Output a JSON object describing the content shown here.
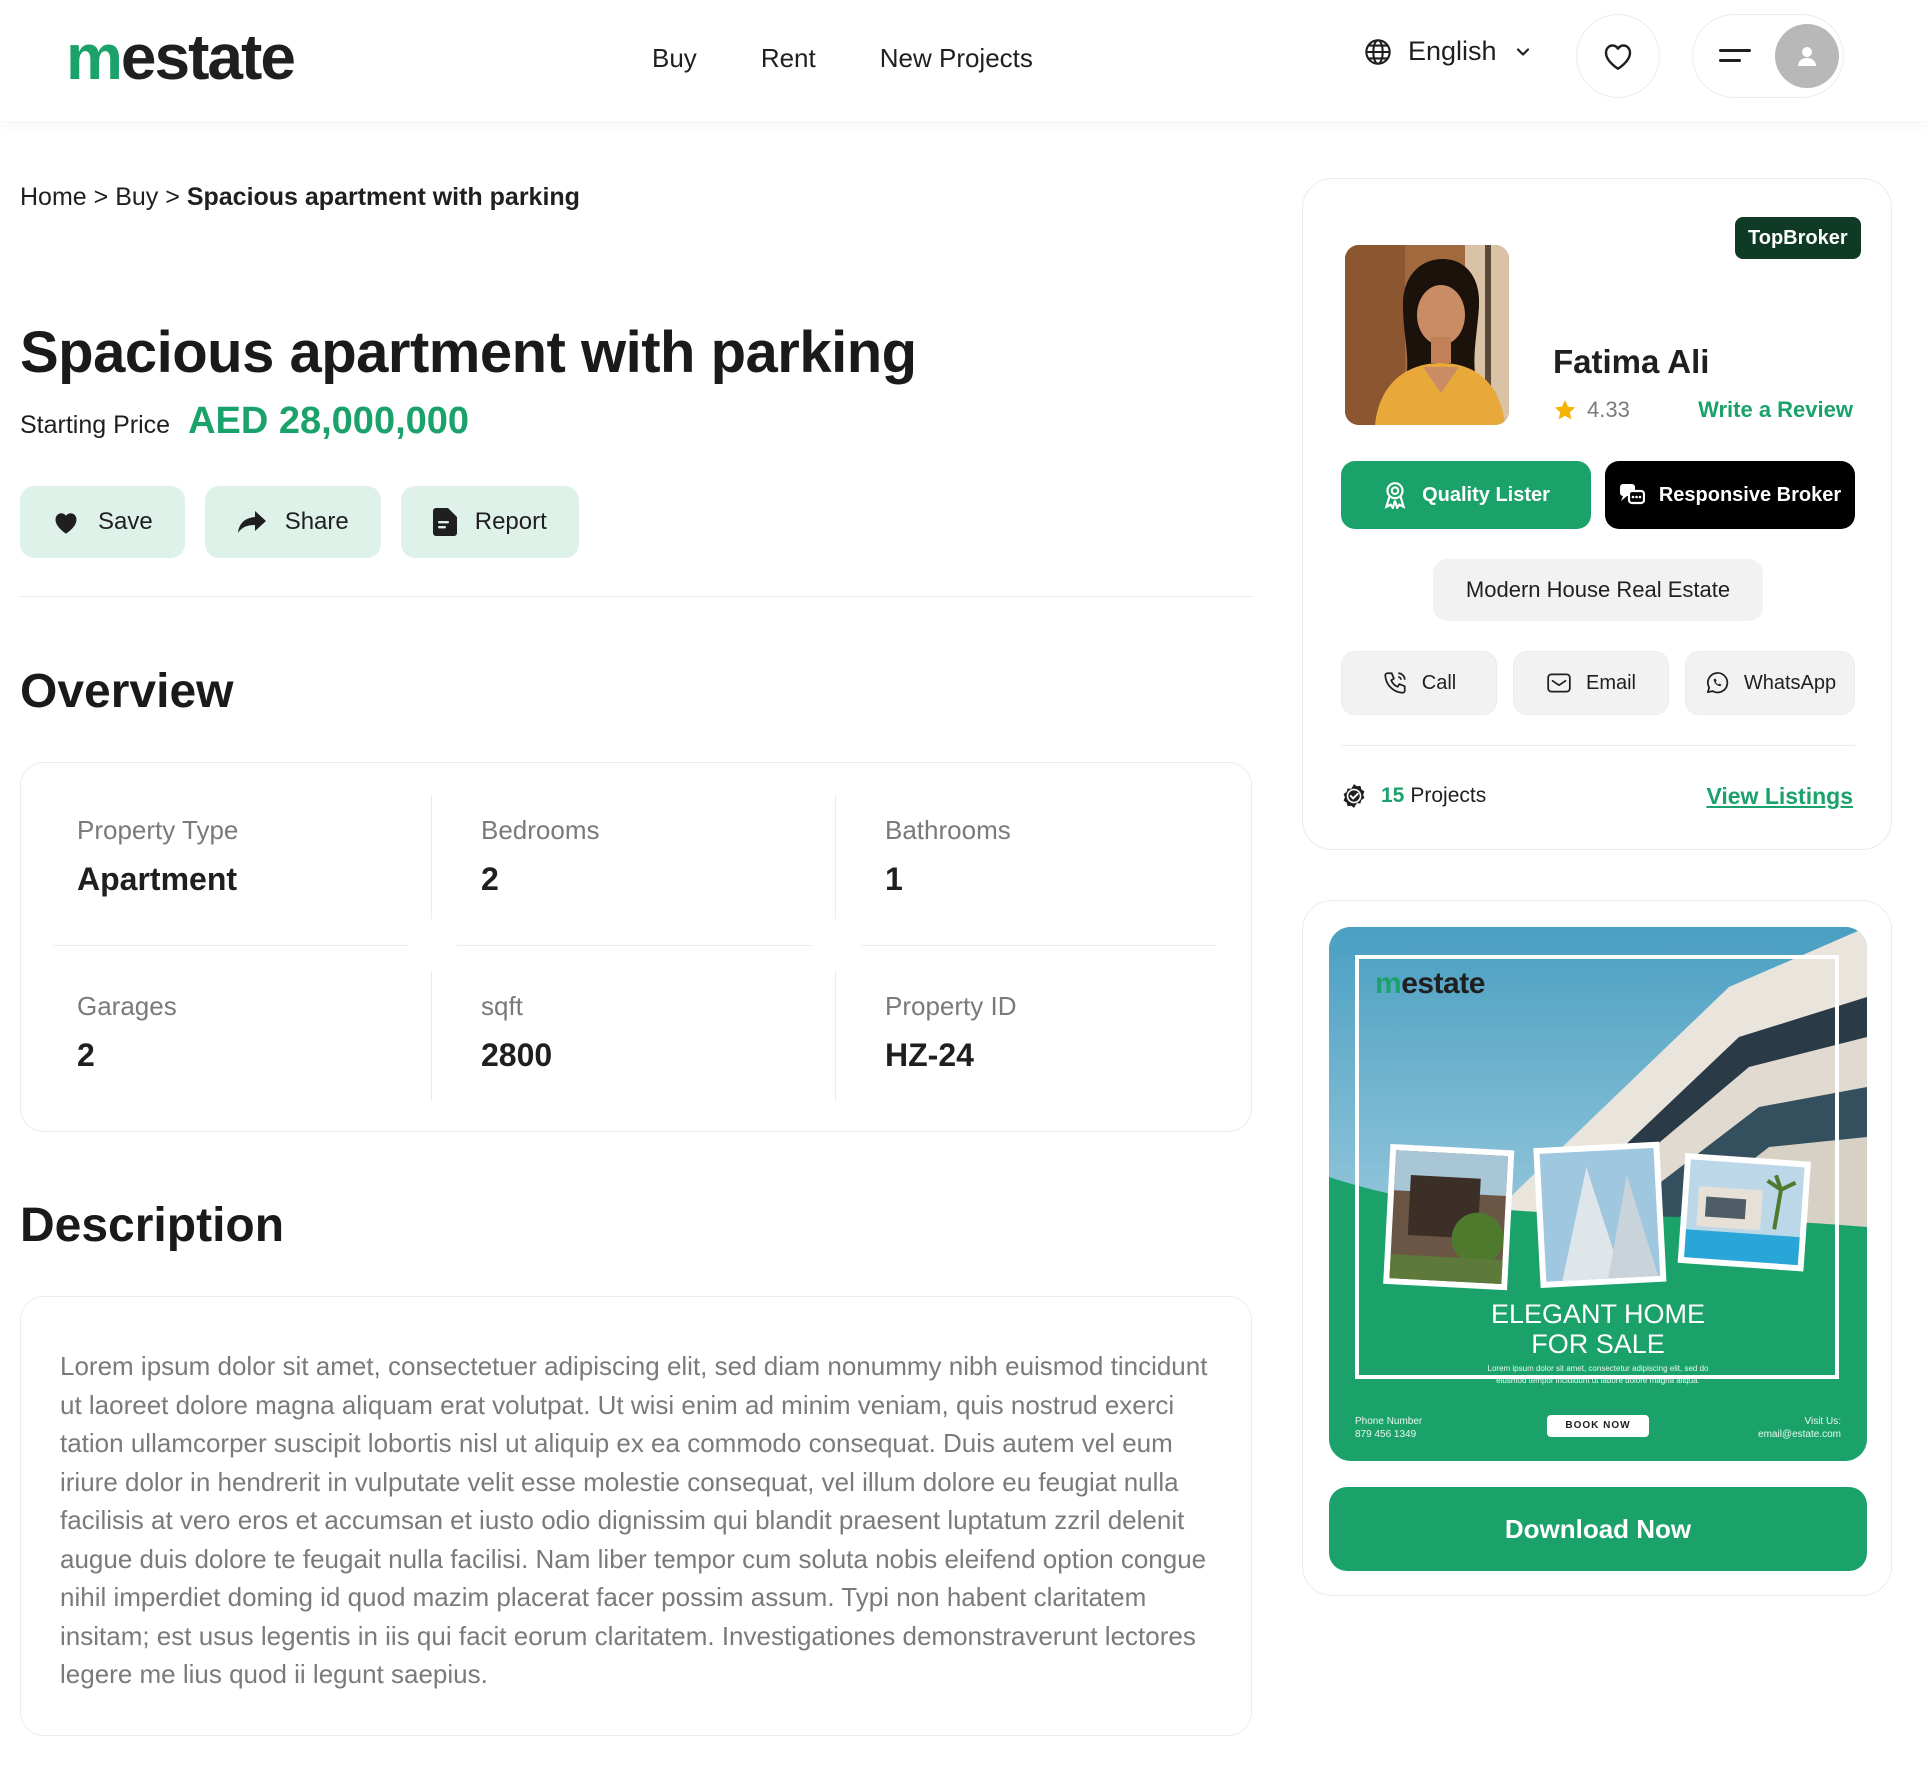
{
  "header": {
    "logo_lead": "m",
    "logo_rest": "estate",
    "nav": [
      {
        "label": "Buy"
      },
      {
        "label": "Rent"
      },
      {
        "label": "New Projects"
      }
    ],
    "language": "English",
    "icons": {
      "language": "globe-icon",
      "dropdown": "chevron-down-icon",
      "favorites": "heart-icon",
      "menu": "hamburger-menu-icon",
      "user": "user-avatar-icon"
    }
  },
  "breadcrumb": {
    "home": "Home",
    "separator": ">",
    "section": "Buy",
    "current": "Spacious apartment with parking"
  },
  "listing": {
    "title": "Spacious apartment with parking",
    "price_label": "Starting Price",
    "price": "AED 28,000,000",
    "actions": {
      "save": "Save",
      "share": "Share",
      "report": "Report"
    }
  },
  "overview": {
    "title": "Overview",
    "items": [
      {
        "label": "Property Type",
        "value": "Apartment"
      },
      {
        "label": "Bedrooms",
        "value": "2"
      },
      {
        "label": "Bathrooms",
        "value": "1"
      },
      {
        "label": "Garages",
        "value": "2"
      },
      {
        "label": "sqft",
        "value": "2800"
      },
      {
        "label": "Property ID",
        "value": "HZ-24"
      }
    ]
  },
  "description": {
    "title": "Description",
    "text": "Lorem ipsum dolor sit amet, consectetuer adipiscing elit, sed diam nonummy nibh euismod tincidunt ut laoreet dolore magna aliquam erat volutpat. Ut wisi enim ad minim veniam, quis nostrud exerci tation ullamcorper suscipit lobortis nisl ut aliquip ex ea commodo consequat. Duis autem vel eum iriure dolor in hendrerit in vulputate velit esse molestie consequat, vel illum dolore eu feugiat nulla facilisis at vero eros et accumsan et iusto odio dignissim qui blandit praesent luptatum zzril delenit augue duis dolore te feugait nulla facilisi. Nam liber tempor cum soluta nobis eleifend option congue nihil imperdiet doming id quod mazim placerat facer possim assum. Typi non habent claritatem insitam; est usus legentis in iis qui facit eorum claritatem. Investigationes demonstraverunt lectores legere me lius quod ii legunt saepius."
  },
  "broker": {
    "badge": "TopBroker",
    "name": "Fatima Ali",
    "rating": "4.33",
    "write_review": "Write a Review",
    "quality_badge": "Quality Lister",
    "responsive_badge": "Responsive Broker",
    "agency": "Modern House Real Estate",
    "contacts": {
      "call": "Call",
      "email": "Email",
      "whatsapp": "WhatsApp"
    },
    "projects_count": "15",
    "projects_label": "Projects",
    "view_listings": "View Listings"
  },
  "promo": {
    "logo_lead": "m",
    "logo_rest": "estate",
    "headline_1": "ELEGANT HOME",
    "headline_2": "FOR SALE",
    "small_text_1": "Lorem ipsum dolor sit amet, consectetur adipiscing elit, sed do",
    "small_text_2": "eiusmod tempor incididunt ut labore dolore magna aliqua.",
    "phone_label": "Phone Number",
    "phone": "879 456 1349",
    "book": "BOOK NOW",
    "visit_label": "Visit Us:",
    "visit_email": "email@estate.com",
    "download": "Download Now"
  },
  "colors": {
    "accent": "#1ba26b",
    "accent_soft": "#dff2ea",
    "dark_badge": "#0f3a26",
    "text": "#1f1f1f",
    "muted": "#7a7a7a"
  }
}
